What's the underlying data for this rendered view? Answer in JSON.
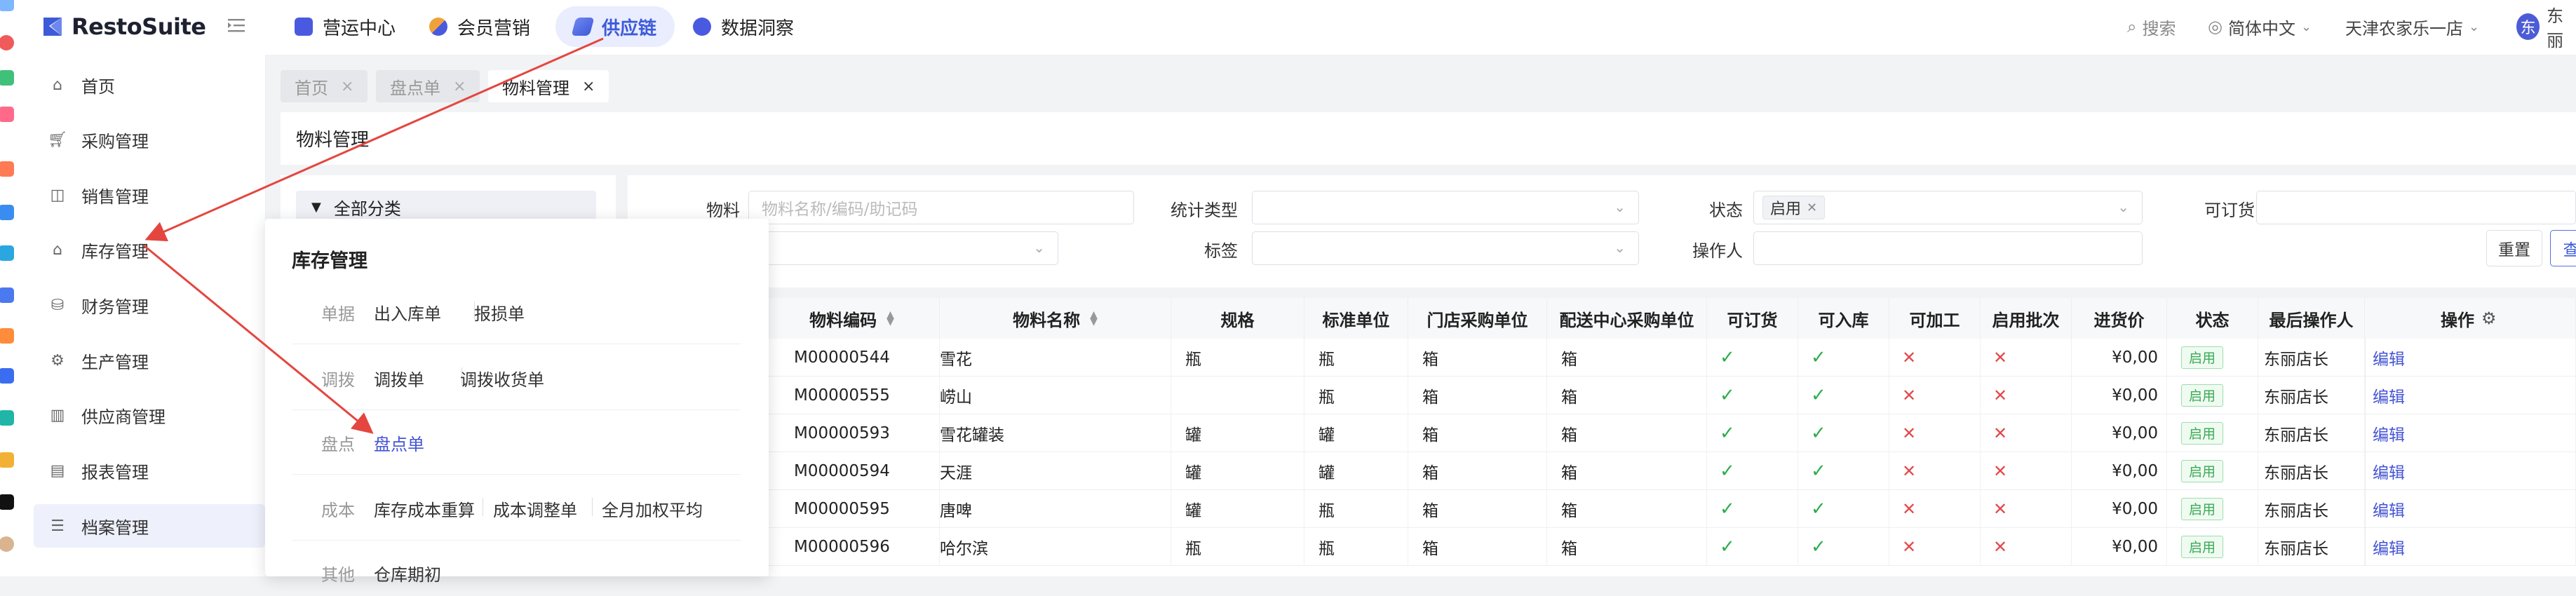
{
  "app": {
    "name": "RestoSuite"
  },
  "top_tabs": [
    {
      "label": "营运中心",
      "icon": "operations-icon",
      "color": "#4a5ae0"
    },
    {
      "label": "会员营销",
      "icon": "member-marketing-icon",
      "color": "#f0a23a"
    },
    {
      "label": "供应链",
      "icon": "supply-chain-icon",
      "color": "#3d5bd9"
    },
    {
      "label": "数据洞察",
      "icon": "data-insight-icon",
      "color": "#4a5ae0"
    }
  ],
  "topbar_right": {
    "search": "搜索",
    "language": "简体中文",
    "store": "天津农家乐一店",
    "avatar_char": "东",
    "user": "东丽"
  },
  "sidebar": {
    "items": [
      {
        "label": "首页",
        "icon": "home-icon"
      },
      {
        "label": "采购管理",
        "icon": "cart-icon"
      },
      {
        "label": "销售管理",
        "icon": "bag-icon"
      },
      {
        "label": "库存管理",
        "icon": "warehouse-icon"
      },
      {
        "label": "财务管理",
        "icon": "finance-icon"
      },
      {
        "label": "生产管理",
        "icon": "production-icon"
      },
      {
        "label": "供应商管理",
        "icon": "supplier-icon"
      },
      {
        "label": "报表管理",
        "icon": "report-icon"
      },
      {
        "label": "档案管理",
        "icon": "archive-icon"
      }
    ]
  },
  "page_tabs": [
    {
      "label": "首页",
      "close": "×"
    },
    {
      "label": "盘点单",
      "close": "×"
    },
    {
      "label": "物料管理",
      "close": "×"
    }
  ],
  "page_title": "物料管理",
  "category": {
    "all_label": "全部分类"
  },
  "filters": {
    "material_label": "物料",
    "material_placeholder": "物料名称/编码/助记码",
    "stat_type_label": "统计类型",
    "status_label": "状态",
    "status_tag": "启用",
    "orderable_label": "可订货",
    "tag_label": "标签",
    "operator_label": "操作人",
    "reset_label": "重置",
    "query_label": "查"
  },
  "table": {
    "columns": [
      "物料编码",
      "物料名称",
      "规格",
      "标准单位",
      "门店采购单位",
      "配送中心采购单位",
      "可订货",
      "可入库",
      "可加工",
      "启用批次",
      "进货价",
      "状态",
      "最后操作人",
      "操作"
    ],
    "rows": [
      {
        "code": "M00000544",
        "name": "雪花",
        "spec": "瓶",
        "unit": "瓶",
        "store_unit": "箱",
        "dc_unit": "箱",
        "orderable": "✓",
        "stockable": "✓",
        "processable": "✕",
        "batch": "✕",
        "price": "¥0,00",
        "status": "启用",
        "operator": "东丽店长",
        "action": "编辑"
      },
      {
        "code": "M00000555",
        "name": "崂山",
        "spec": "",
        "unit": "瓶",
        "store_unit": "箱",
        "dc_unit": "箱",
        "orderable": "✓",
        "stockable": "✓",
        "processable": "✕",
        "batch": "✕",
        "price": "¥0,00",
        "status": "启用",
        "operator": "东丽店长",
        "action": "编辑"
      },
      {
        "code": "M00000593",
        "name": "雪花罐装",
        "spec": "罐",
        "unit": "罐",
        "store_unit": "箱",
        "dc_unit": "箱",
        "orderable": "✓",
        "stockable": "✓",
        "processable": "✕",
        "batch": "✕",
        "price": "¥0,00",
        "status": "启用",
        "operator": "东丽店长",
        "action": "编辑"
      },
      {
        "code": "M00000594",
        "name": "天涯",
        "spec": "罐",
        "unit": "罐",
        "store_unit": "箱",
        "dc_unit": "箱",
        "orderable": "✓",
        "stockable": "✓",
        "processable": "✕",
        "batch": "✕",
        "price": "¥0,00",
        "status": "启用",
        "operator": "东丽店长",
        "action": "编辑"
      },
      {
        "code": "M00000595",
        "name": "唐啤",
        "spec": "罐",
        "unit": "瓶",
        "store_unit": "箱",
        "dc_unit": "箱",
        "orderable": "✓",
        "stockable": "✓",
        "processable": "✕",
        "batch": "✕",
        "price": "¥0,00",
        "status": "启用",
        "operator": "东丽店长",
        "action": "编辑"
      },
      {
        "code": "M00000596",
        "name": "哈尔滨",
        "spec": "瓶",
        "unit": "瓶",
        "store_unit": "箱",
        "dc_unit": "箱",
        "orderable": "✓",
        "stockable": "✓",
        "processable": "✕",
        "batch": "✕",
        "price": "¥0,00",
        "status": "启用",
        "operator": "东丽店长",
        "action": "编辑"
      }
    ]
  },
  "mega_menu": {
    "title": "库存管理",
    "groups": [
      {
        "label": "单据",
        "items": [
          "出入库单",
          "报损单"
        ]
      },
      {
        "label": "调拨",
        "items": [
          "调拨单",
          "调拨收货单"
        ]
      },
      {
        "label": "盘点",
        "items": [
          "盘点单"
        ]
      },
      {
        "label": "成本",
        "items": [
          "库存成本重算",
          "成本调整单",
          "全月加权平均"
        ]
      },
      {
        "label": "其他",
        "items": [
          "仓库期初"
        ]
      }
    ]
  },
  "colors": {
    "accent": "#3d5bd9",
    "link": "#4454d4",
    "check": "#2dad4d",
    "cross": "#e3484b",
    "arrow": "#e4463f"
  }
}
